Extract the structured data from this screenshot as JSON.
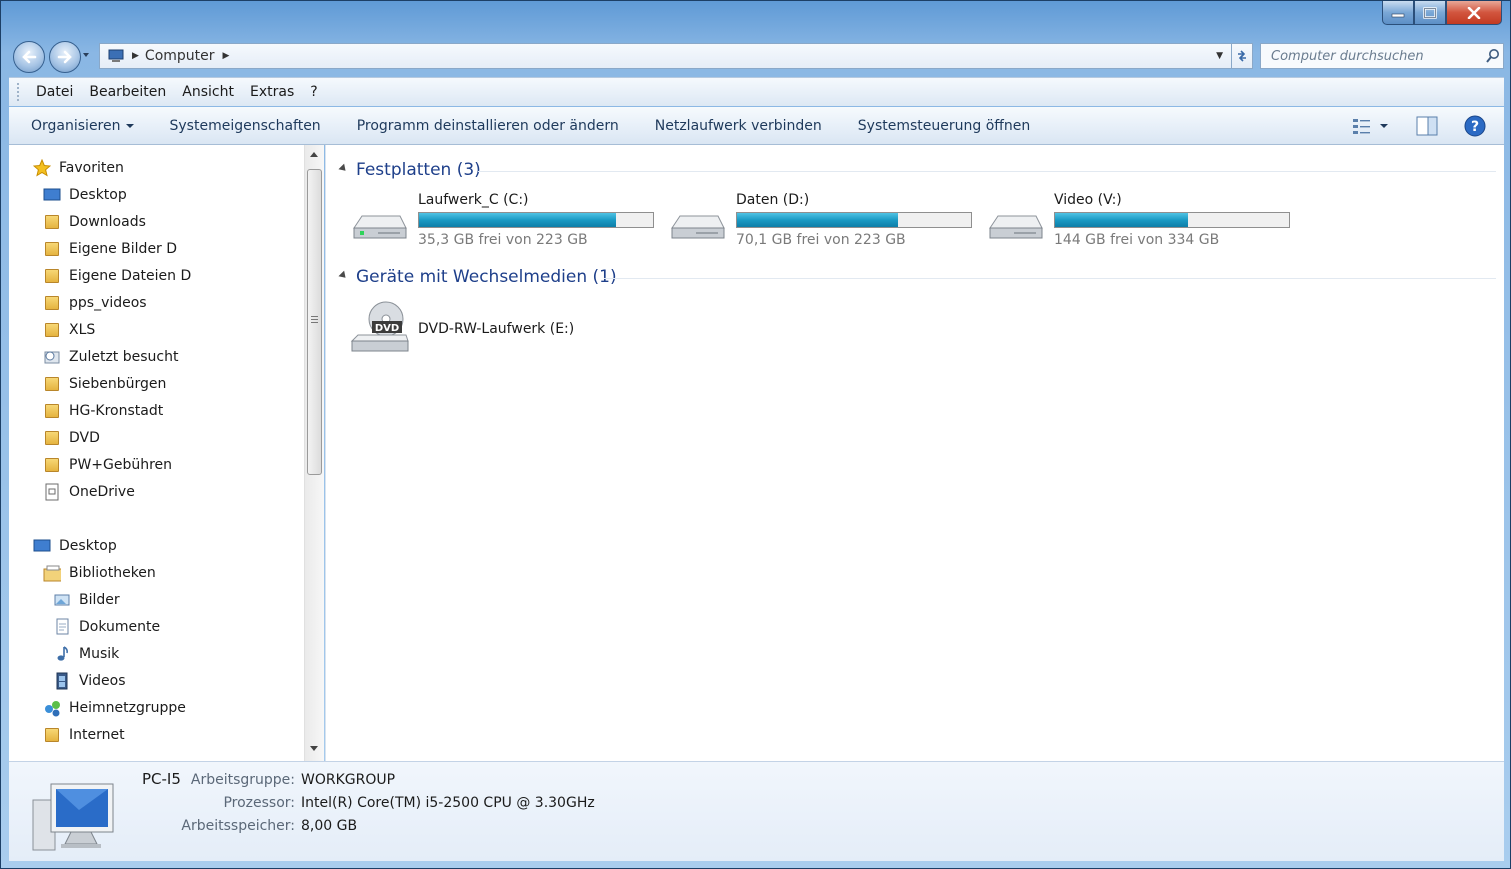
{
  "window": {
    "caption": {
      "minimize": "–",
      "maximize": "□",
      "close": "✕"
    }
  },
  "addressbar": {
    "crumbs": [
      "Computer"
    ],
    "search_placeholder": "Computer durchsuchen"
  },
  "menubar": [
    "Datei",
    "Bearbeiten",
    "Ansicht",
    "Extras",
    "?"
  ],
  "commandbar": {
    "organize": "Organisieren",
    "items": [
      "Systemeigenschaften",
      "Programm deinstallieren oder ändern",
      "Netzlaufwerk verbinden",
      "Systemsteuerung öffnen"
    ]
  },
  "navpane": {
    "favorites_header": "Favoriten",
    "favorites": [
      "Desktop",
      "Downloads",
      "Eigene Bilder D",
      "Eigene Dateien D",
      "pps_videos",
      "XLS",
      "Zuletzt besucht",
      "Siebenbürgen",
      "HG-Kronstadt",
      "DVD",
      "PW+Gebühren",
      "OneDrive"
    ],
    "desktop_header": "Desktop",
    "libraries": "Bibliotheken",
    "library_items": [
      "Bilder",
      "Dokumente",
      "Musik",
      "Videos"
    ],
    "homegroup": "Heimnetzgruppe",
    "internet": "Internet"
  },
  "content": {
    "group_hdd": "Festplatten (3)",
    "drives": [
      {
        "name": "Laufwerk_C (C:)",
        "free": "35,3 GB frei von 223 GB",
        "used_fraction": 0.842
      },
      {
        "name": "Daten (D:)",
        "free": "70,1 GB frei von 223 GB",
        "used_fraction": 0.686
      },
      {
        "name": "Video (V:)",
        "free": "144 GB frei von 334 GB",
        "used_fraction": 0.569
      }
    ],
    "group_removable": "Geräte mit Wechselmedien (1)",
    "removable": [
      {
        "name": "DVD-RW-Laufwerk (E:)",
        "icon_label": "DVD"
      }
    ]
  },
  "details": {
    "pc_name": "PC-I5",
    "rows": [
      {
        "label": "Arbeitsgruppe:",
        "value": "WORKGROUP"
      },
      {
        "label": "Prozessor:",
        "value": "Intel(R) Core(TM) i5-2500 CPU @ 3.30GHz"
      },
      {
        "label": "Arbeitsspeicher:",
        "value": "8,00 GB"
      }
    ]
  },
  "colors": {
    "accent": "#1e3f8a",
    "bar_fill": "#1a9ac4"
  }
}
